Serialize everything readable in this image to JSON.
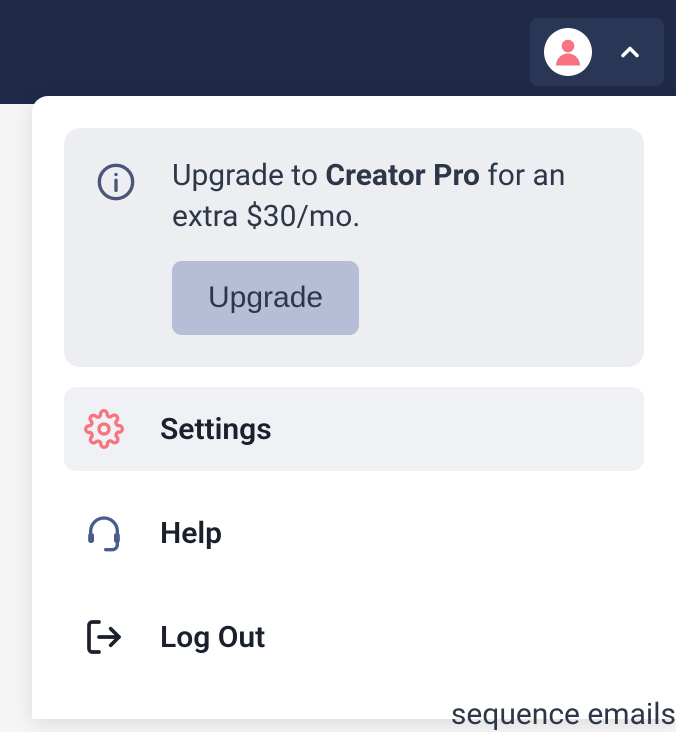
{
  "upgrade": {
    "prefix": "Upgrade to ",
    "plan_name": "Creator Pro",
    "suffix": " for an extra $30/mo.",
    "button_label": "Upgrade"
  },
  "menu": {
    "settings": "Settings",
    "help": "Help",
    "logout": "Log Out"
  },
  "background": {
    "partial_text": "sequence emails"
  }
}
